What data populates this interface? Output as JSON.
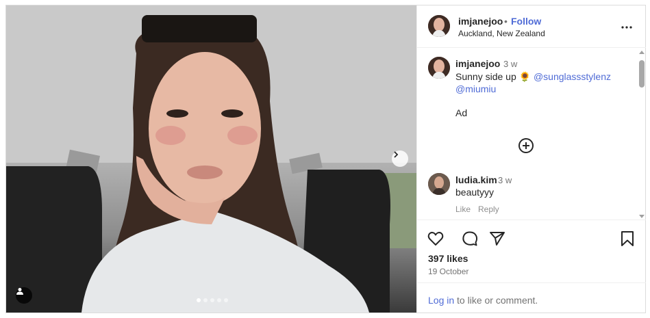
{
  "post": {
    "username": "imjanejoo",
    "separator": "•",
    "follow_label": "Follow",
    "location": "Auckland, New Zealand",
    "more_icon": "more-horizontal-icon"
  },
  "caption": {
    "username": "imjanejoo",
    "time": "3 w",
    "text": "Sunny side up 🌻",
    "mention_1": "@sunglassstylenz",
    "mention_2": "@miumiu",
    "ad_label": "Ad",
    "load_more_icon": "plus-circle-icon"
  },
  "comment": {
    "username": "ludia.kim",
    "time": "3 w",
    "text": "beautyyy",
    "like_label": "Like",
    "reply_label": "Reply"
  },
  "actions": {
    "likes": "397 likes",
    "date": "19 October",
    "login_link": "Log in",
    "login_rest": " to like or comment."
  },
  "carousel": {
    "slide_count": 5,
    "active_index": 0
  },
  "colors": {
    "link": "#4f6bd6",
    "text": "#262626",
    "muted": "#737373",
    "border": "#dbdbdb"
  }
}
